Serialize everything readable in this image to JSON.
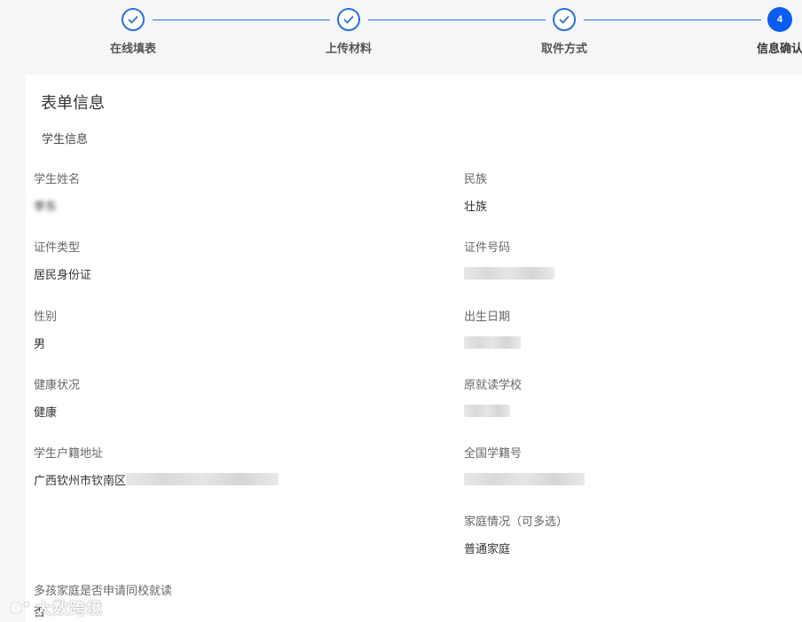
{
  "stepper": {
    "steps": [
      {
        "label": "在线填表",
        "state": "done"
      },
      {
        "label": "上传材料",
        "state": "done"
      },
      {
        "label": "取件方式",
        "state": "done"
      },
      {
        "label": "信息确认",
        "state": "active",
        "number": "4"
      }
    ],
    "accent_color": "#2a6fdb",
    "active_color": "#0b5cf0"
  },
  "card": {
    "title": "表单信息",
    "section_title": "学生信息"
  },
  "fields": {
    "student_name": {
      "label": "学生姓名",
      "value": "李东"
    },
    "ethnicity": {
      "label": "民族",
      "value": "壮族"
    },
    "id_type": {
      "label": "证件类型",
      "value": "居民身份证"
    },
    "id_number": {
      "label": "证件号码",
      "value": ""
    },
    "gender": {
      "label": "性别",
      "value": "男"
    },
    "birth_date": {
      "label": "出生日期",
      "value": ""
    },
    "health": {
      "label": "健康状况",
      "value": "健康"
    },
    "previous_school": {
      "label": "原就读学校",
      "value": ""
    },
    "household_address": {
      "label": "学生户籍地址",
      "value": "广西钦州市钦南区"
    },
    "national_student_id": {
      "label": "全国学籍号",
      "value": ""
    },
    "family_situation": {
      "label": "家庭情况（可多选）",
      "value": "普通家庭"
    },
    "multi_child": {
      "label": "多孩家庭是否申请同校就读",
      "value": "否"
    }
  },
  "watermark": {
    "text": "大数跨境",
    "icon": "watermark-logo-icon"
  }
}
